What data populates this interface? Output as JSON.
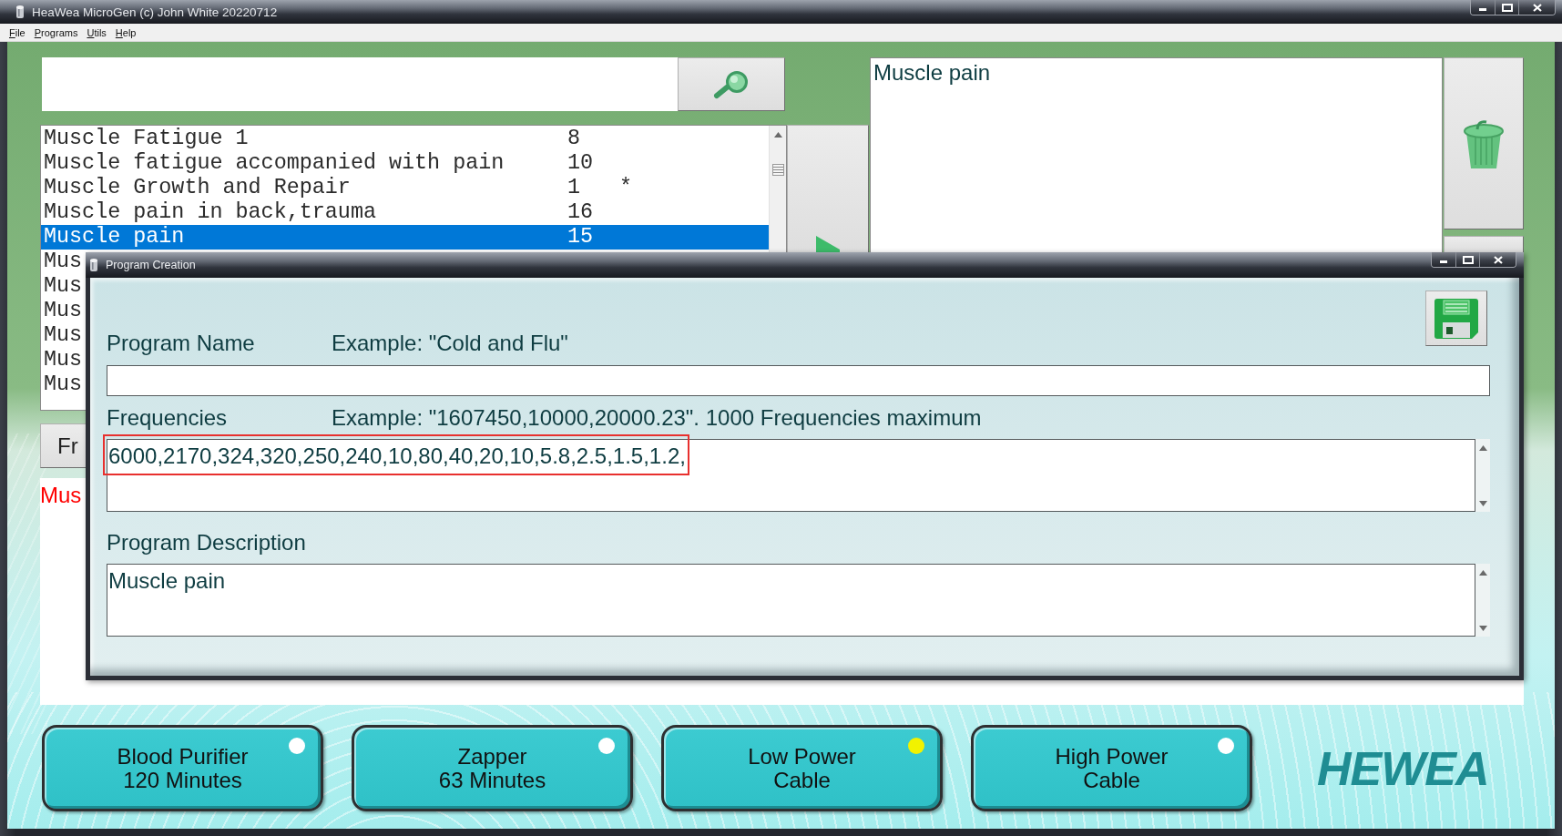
{
  "window": {
    "title": "HeaWea MicroGen (c) John White 20220712"
  },
  "menu": [
    "File",
    "Programs",
    "Utils",
    "Help"
  ],
  "program_list": {
    "rows": [
      {
        "name": "Muscle Fatigue 1",
        "number": "8",
        "selected": false
      },
      {
        "name": "Muscle fatigue accompanied with pain",
        "number": "10",
        "selected": false
      },
      {
        "name": "Muscle Growth and Repair",
        "number": "1",
        "marker": "*",
        "selected": false
      },
      {
        "name": "Muscle pain in back,trauma",
        "number": "16",
        "selected": false
      },
      {
        "name": "Muscle pain",
        "number": "15",
        "selected": true
      },
      {
        "name": "Mus",
        "selected": false
      },
      {
        "name": "Mus",
        "selected": false
      },
      {
        "name": "Mus",
        "selected": false
      },
      {
        "name": "Mus",
        "selected": false
      },
      {
        "name": "Mus",
        "selected": false
      },
      {
        "name": "Mus",
        "selected": false
      }
    ]
  },
  "description_box": {
    "value": "Muscle pain"
  },
  "bar_button": {
    "label": "Fr"
  },
  "text_panel": {
    "text": "Mus"
  },
  "dialog": {
    "title": "Program Creation",
    "fields": [
      {
        "kind": "line",
        "label": "Program Name",
        "example": "Example: \"Cold and Flu\"",
        "highlighted": false
      },
      {
        "kind": "area",
        "label": "Frequencies",
        "example": "Example: \"1607450,10000,20000.23\". 1000 Frequencies maximum",
        "value": "6000,2170,324,320,250,240,10,80,40,20,10,5.8,2.5,1.5,1.2,",
        "highlighted": true
      },
      {
        "kind": "area",
        "label": "Program Description",
        "value": "Muscle pain",
        "highlighted": false
      }
    ]
  },
  "mode_buttons": [
    {
      "lines": [
        "Blood Purifier",
        "120 Minutes"
      ],
      "on": false
    },
    {
      "lines": [
        "Zapper",
        "63 Minutes"
      ],
      "on": false
    },
    {
      "lines": [
        "Low Power",
        "Cable"
      ],
      "on": true
    },
    {
      "lines": [
        "High Power",
        "Cable"
      ],
      "on": false
    }
  ],
  "logo": {
    "text": "HEWEA"
  }
}
